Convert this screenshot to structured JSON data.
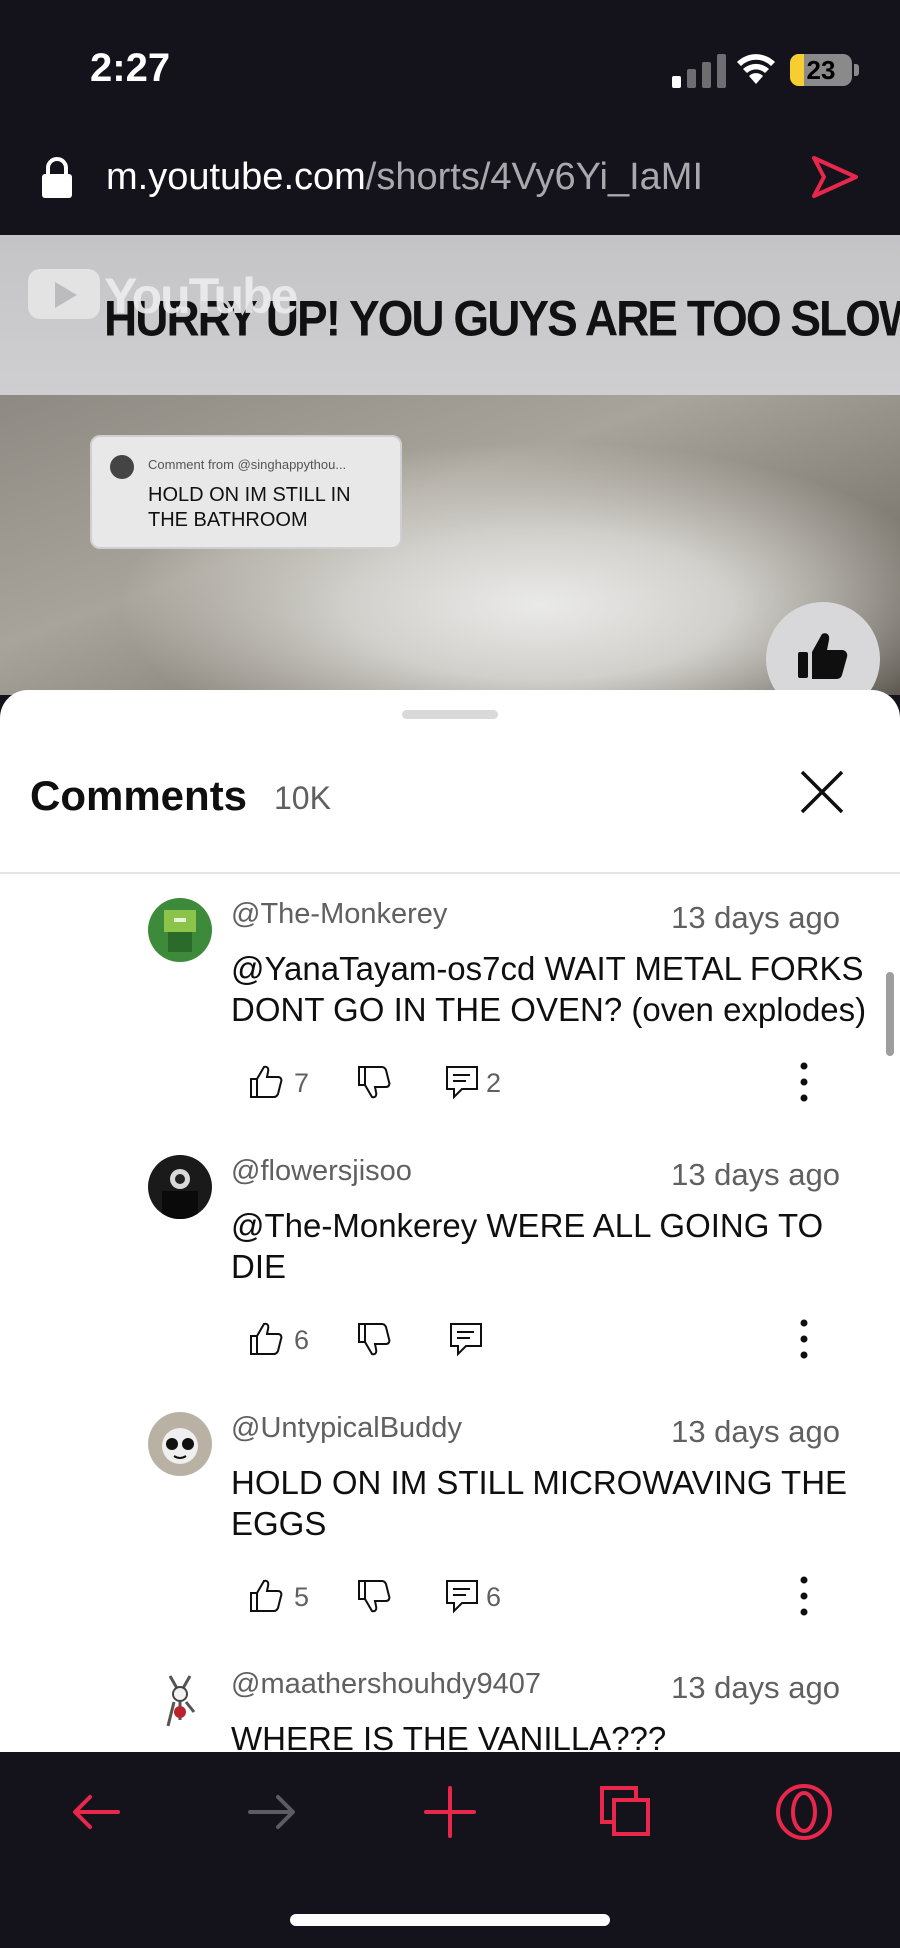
{
  "status_bar": {
    "time": "2:27",
    "battery_level": "23",
    "battery_fraction": 0.23
  },
  "browser": {
    "url_domain": "m.youtube.com",
    "url_path": "/shorts/4Vy6Yi_IaMI"
  },
  "video": {
    "watermark": "YouTube",
    "banner_text": "HURRY UP! YOU GUYS ARE TOO SLOW",
    "sticker_from": "Comment from @singhappythou...",
    "sticker_text": "HOLD ON IM STILL IN THE BATHROOM"
  },
  "comments_sheet": {
    "title": "Comments",
    "count": "10K",
    "comments": [
      {
        "author": "@The-Monkerey",
        "when": "13 days ago",
        "text": "@YanaTayam-os7cd WAIT METAL FORKS DONT GO IN THE OVEN? (oven explodes)",
        "likes": "7",
        "replies": "2"
      },
      {
        "author": "@flowersjisoo",
        "when": "13 days ago",
        "text": "@The-Monkerey WERE ALL GOING TO DIE",
        "likes": "6",
        "replies": ""
      },
      {
        "author": "@UntypicalBuddy",
        "when": "13 days ago",
        "text": "HOLD ON IM STILL MICROWAVING THE EGGS",
        "likes": "5",
        "replies": "6"
      },
      {
        "author": "@maathershouhdy9407",
        "when": "13 days ago",
        "text": "WHERE IS THE VANILLA???",
        "likes": "",
        "replies": ""
      }
    ]
  },
  "colors": {
    "accent": "#e8274b",
    "browser_bg": "#14131c",
    "battery_yellow": "#f6ce32"
  },
  "icons": {
    "back": "arrow-left-icon",
    "forward": "arrow-right-icon",
    "new_tab": "plus-icon",
    "tabs": "tabs-icon",
    "menu": "opera-logo-icon"
  }
}
